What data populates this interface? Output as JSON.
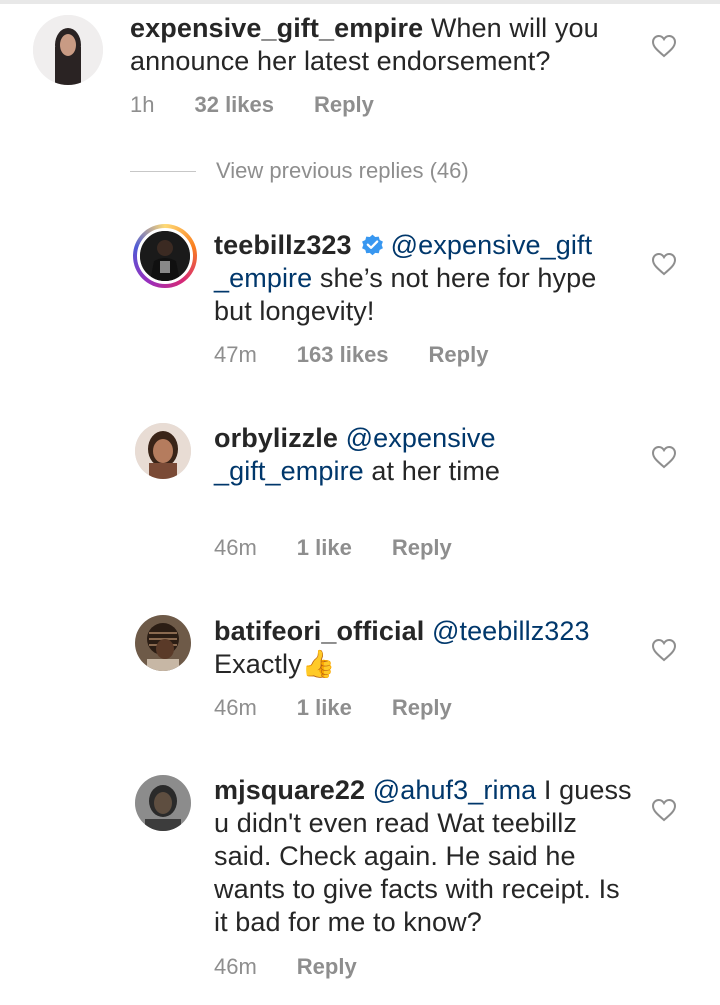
{
  "comments": [
    {
      "username": "expensive_gift_empire",
      "mention": "",
      "body": "When will you announce her latest endorsement?",
      "time": "1h",
      "likes": "32 likes",
      "reply": "Reply",
      "verified": false
    },
    {
      "username": "teebillz323",
      "mention": "@expensive_gift _empire",
      "body": "she’s not here for hype but longevity!",
      "time": "47m",
      "likes": "163 likes",
      "reply": "Reply",
      "verified": true
    },
    {
      "username": "orbylizzle",
      "mention": "@expensive _gift_empire",
      "body": "at her time",
      "time": "46m",
      "likes": "1 like",
      "reply": "Reply",
      "verified": false
    },
    {
      "username": "batifeori_official",
      "mention": "@teebillz323",
      "body": "Exactly👍",
      "time": "46m",
      "likes": "1 like",
      "reply": "Reply",
      "verified": false
    },
    {
      "username": "mjsquare22",
      "mention": "@ahuf3_rima",
      "body": "I guess u didn't even read Wat teebillz said. Check again. He said he wants to give facts  with receipt. Is it bad for me to know?",
      "time": "46m",
      "likes": "",
      "reply": "Reply",
      "verified": false
    }
  ],
  "view_previous": "View previous replies (46)",
  "colors": {
    "text": "#262626",
    "meta": "#8e8e8e",
    "mention": "#00376b",
    "verified": "#3897f0"
  },
  "icons": {
    "like": "heart-outline-icon",
    "verified": "verified-badge-icon"
  }
}
